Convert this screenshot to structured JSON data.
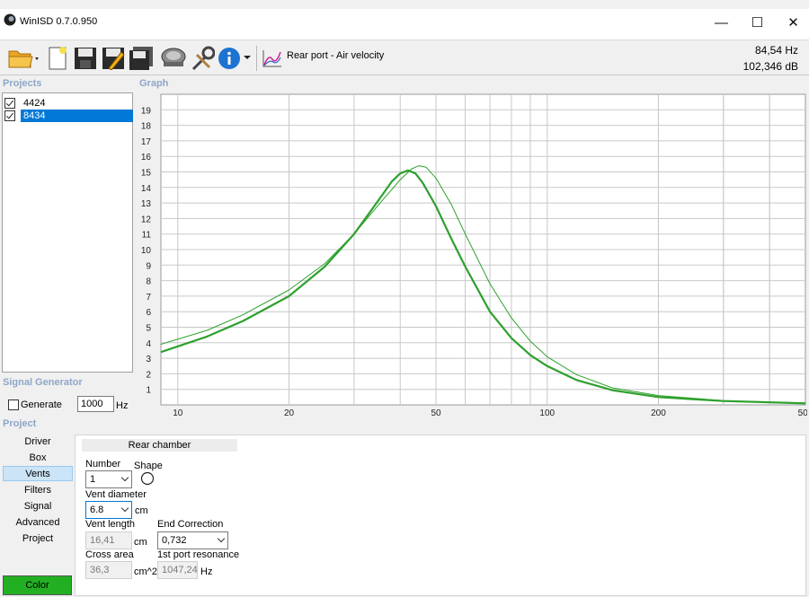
{
  "window": {
    "title": "WinISD 0.7.0.950",
    "controls": {
      "minimize": "—",
      "maximize": "☐",
      "close": "✕"
    }
  },
  "toolbar": {
    "graph_selector": "Rear port - Air velocity",
    "readout_freq": "84,54 Hz",
    "readout_db": "102,346 dB",
    "icons": [
      "open-folder-icon",
      "new-project-icon",
      "save-icon",
      "save-as-icon",
      "save-all-icon",
      "driver-icon",
      "wrench-icon",
      "info-icon",
      "graph-icon"
    ]
  },
  "projects": {
    "label": "Projects",
    "items": [
      {
        "name": "4424",
        "checked": true,
        "selected": false
      },
      {
        "name": "8434",
        "checked": true,
        "selected": true
      }
    ]
  },
  "graph": {
    "label": "Graph",
    "line_color": "#2ea02e"
  },
  "signal_generator": {
    "label": "Signal Generator",
    "generate_label": "Generate",
    "frequency": "1000",
    "unit": "Hz"
  },
  "project": {
    "label": "Project",
    "nav": [
      "Driver",
      "Box",
      "Vents",
      "Filters",
      "Signal",
      "Advanced",
      "Project"
    ],
    "active_nav": "Vents",
    "color_button": "Color",
    "color_value": "#22b022"
  },
  "vents": {
    "section_title": "Rear chamber",
    "number_label": "Number",
    "number_value": "1",
    "shape_label": "Shape",
    "vent_diameter_label": "Vent diameter",
    "vent_diameter_value": "6.8",
    "vent_diameter_unit": "cm",
    "vent_length_label": "Vent length",
    "vent_length_value": "16,41",
    "vent_length_unit": "cm",
    "end_correction_label": "End Correction",
    "end_correction_value": "0,732",
    "cross_area_label": "Cross area",
    "cross_area_value": "36,3",
    "cross_area_unit": "cm^2",
    "port_resonance_label": "1st port resonance",
    "port_resonance_value": "1047,24",
    "port_resonance_unit": "Hz"
  },
  "chart_data": {
    "type": "line",
    "title": "",
    "xlabel": "",
    "ylabel": "",
    "x_scale": "log",
    "xlim": [
      9,
      500
    ],
    "ylim": [
      0,
      20
    ],
    "x_tick_labels": [
      "10",
      "20",
      "50",
      "100",
      "200",
      "500"
    ],
    "y_tick_labels": [
      "1",
      "2",
      "3",
      "4",
      "5",
      "6",
      "7",
      "8",
      "9",
      "10",
      "11",
      "12",
      "13",
      "14",
      "15",
      "16",
      "17",
      "18",
      "19"
    ],
    "grid": true,
    "series": [
      {
        "color": "#2ea02e",
        "style": "thick",
        "points": [
          [
            9,
            3.4
          ],
          [
            12,
            4.4
          ],
          [
            15,
            5.4
          ],
          [
            20,
            7.0
          ],
          [
            25,
            8.9
          ],
          [
            30,
            11.0
          ],
          [
            35,
            13.2
          ],
          [
            38,
            14.4
          ],
          [
            40,
            14.9
          ],
          [
            42,
            15.1
          ],
          [
            44,
            14.9
          ],
          [
            46,
            14.3
          ],
          [
            50,
            12.8
          ],
          [
            55,
            10.7
          ],
          [
            60,
            8.9
          ],
          [
            70,
            6.0
          ],
          [
            80,
            4.3
          ],
          [
            90,
            3.2
          ],
          [
            100,
            2.5
          ],
          [
            120,
            1.6
          ],
          [
            150,
            0.95
          ],
          [
            200,
            0.5
          ],
          [
            300,
            0.25
          ],
          [
            500,
            0.1
          ]
        ]
      },
      {
        "color": "#2ea02e",
        "style": "thin",
        "points": [
          [
            9,
            3.9
          ],
          [
            12,
            4.8
          ],
          [
            15,
            5.8
          ],
          [
            20,
            7.4
          ],
          [
            25,
            9.1
          ],
          [
            30,
            11.0
          ],
          [
            35,
            12.9
          ],
          [
            40,
            14.5
          ],
          [
            43,
            15.2
          ],
          [
            45,
            15.4
          ],
          [
            47,
            15.3
          ],
          [
            50,
            14.6
          ],
          [
            55,
            12.9
          ],
          [
            60,
            11.0
          ],
          [
            70,
            7.8
          ],
          [
            80,
            5.6
          ],
          [
            90,
            4.1
          ],
          [
            100,
            3.1
          ],
          [
            120,
            1.95
          ],
          [
            150,
            1.1
          ],
          [
            200,
            0.6
          ],
          [
            300,
            0.28
          ],
          [
            500,
            0.12
          ]
        ]
      }
    ]
  }
}
